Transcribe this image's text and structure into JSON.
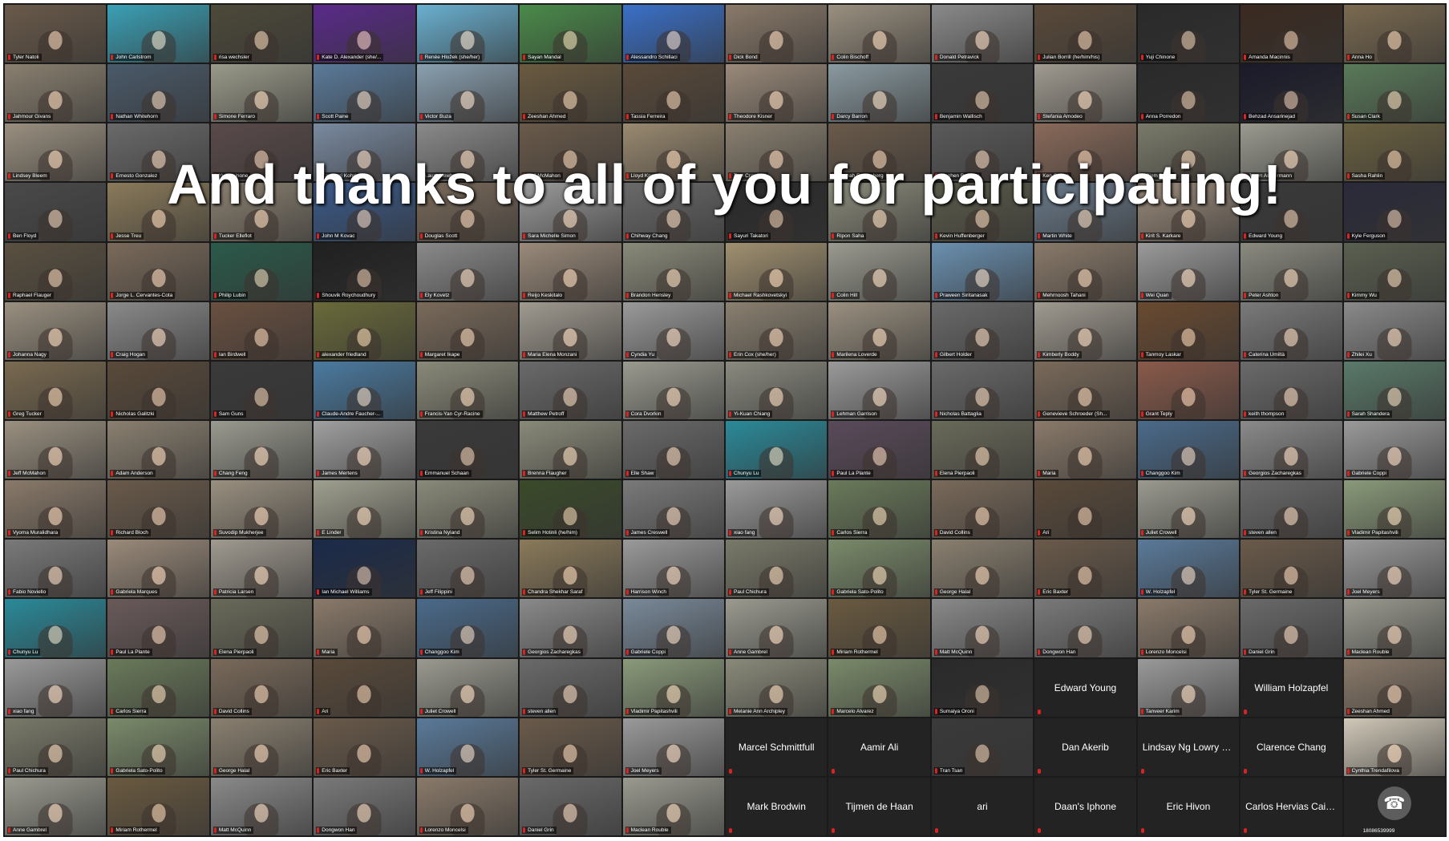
{
  "banner": "And thanks to all of you for participating!",
  "tiles": [
    {
      "n": "Tyler Natoli",
      "c": "#6a5a4a"
    },
    {
      "n": "John Carlstrom",
      "c": "#3aa0b5"
    },
    {
      "n": "risa wechsler",
      "c": "#4d4a3a"
    },
    {
      "n": "Kate D. Alexander (she/...",
      "c": "#5a2a8a"
    },
    {
      "n": "Renée Hložek (she/her)",
      "c": "#6ab0d0"
    },
    {
      "n": "Sayan Mandal",
      "c": "#4a8a4a"
    },
    {
      "n": "Alessandro Schillaci",
      "c": "#3a70c8"
    },
    {
      "n": "Dick Bond",
      "c": "#8a7a6a"
    },
    {
      "n": "Colin Bischoff",
      "c": "#9a9080"
    },
    {
      "n": "Donald Petravick",
      "c": "#8a8a8a"
    },
    {
      "n": "Julian Borrill (he/him/his)",
      "c": "#5a4a3a"
    },
    {
      "n": "Yuji Chinone",
      "c": "#2a2a2a"
    },
    {
      "n": "Amanda Macinnis",
      "c": "#3a2a20"
    },
    {
      "n": "Anna Ho",
      "c": "#7a6a50"
    },
    {
      "n": "Jahmour Givans",
      "c": "#8a8070"
    },
    {
      "n": "Nathan Whitehorn",
      "c": "#4a5a6a"
    },
    {
      "n": "Simone Ferraro",
      "c": "#9a9a8a"
    },
    {
      "n": "Scott Paine",
      "c": "#5a7a9a"
    },
    {
      "n": "Victor Buza",
      "c": "#8aa0b0"
    },
    {
      "n": "Zeeshan Ahmed",
      "c": "#6a5a40"
    },
    {
      "n": "Tassia Ferreira",
      "c": "#5a4a3a"
    },
    {
      "n": "Theodore Kisner",
      "c": "#9a8a7a"
    },
    {
      "n": "Darcy Barron",
      "c": "#8a9aa0"
    },
    {
      "n": "Benjamin Wallisch",
      "c": "#3a3a3a"
    },
    {
      "n": "Stefania Amodeo",
      "c": "#a09a90"
    },
    {
      "n": "Anna Porredon",
      "c": "#2a2a2a"
    },
    {
      "n": "Behzad Ansarinejad",
      "c": "#1a1a2a"
    },
    {
      "n": "Susan Clark",
      "c": "#5a7a5a"
    },
    {
      "n": "Lindsey Bleem",
      "c": "#9a9080"
    },
    {
      "n": "Ernesto Gonzalez",
      "c": "#6a6a6a"
    },
    {
      "n": "Yuji Chinone",
      "c": "#5a4a4a"
    },
    {
      "n": "Kazunori Kohri",
      "c": "#7a8aa0"
    },
    {
      "n": "Laura Newburgh",
      "c": "#8a8a8a"
    },
    {
      "n": "Jeff McMahon",
      "c": "#6a5a4a"
    },
    {
      "n": "Lloyd Knox",
      "c": "#9a8a70"
    },
    {
      "n": "Tom Crawford",
      "c": "#8a8070"
    },
    {
      "n": "Hannah Fronenberg",
      "c": "#6a5a4a"
    },
    {
      "n": "Stephen Bensley",
      "c": "#5a5a5a"
    },
    {
      "n": "Ken Ganga",
      "c": "#8a6a5a"
    },
    {
      "n": "Clem Pryke",
      "c": "#7a7a6a"
    },
    {
      "n": "Jason Austermann",
      "c": "#9a9a90"
    },
    {
      "n": "Sasha Rahlin",
      "c": "#6a6040"
    },
    {
      "n": "Ben Floyd",
      "c": "#4a4a4a"
    },
    {
      "n": "Jesse Treu",
      "c": "#8a7a5a"
    },
    {
      "n": "Tucker Elleflot",
      "c": "#8a8070"
    },
    {
      "n": "John M Kovac",
      "c": "#3a5a8a"
    },
    {
      "n": "Douglas Scott",
      "c": "#7a6a5a"
    },
    {
      "n": "Sara Michelle Simon",
      "c": "#9a9a9a"
    },
    {
      "n": "Chihway Chang",
      "c": "#6a6a6a"
    },
    {
      "n": "Sayuri Takatori",
      "c": "#2a2a2a"
    },
    {
      "n": "Ripon Saha",
      "c": "#8a8a7a"
    },
    {
      "n": "Kevin Huffenberger",
      "c": "#5a5a4a"
    },
    {
      "n": "Martin White",
      "c": "#6a7a8a"
    },
    {
      "n": "Kirit S. Karkare",
      "c": "#9a8a7a"
    },
    {
      "n": "Edward Young",
      "c": "#3a3a3a"
    },
    {
      "n": "Kyle Ferguson",
      "c": "#2a2a3a"
    },
    {
      "n": "Raphael Flauger",
      "c": "#5a5040"
    },
    {
      "n": "Jorge L. Cervantes-Cota",
      "c": "#7a6a5a"
    },
    {
      "n": "Philip Lubin",
      "c": "#2a5a4a"
    },
    {
      "n": "Shouvik Roychoudhury",
      "c": "#202020"
    },
    {
      "n": "Ely Kovetz",
      "c": "#8a8a8a"
    },
    {
      "n": "Reijo Keskitalo",
      "c": "#9a8a7a"
    },
    {
      "n": "Brandon Hensley",
      "c": "#8a8a7a"
    },
    {
      "n": "Michael Rashkovetskyi",
      "c": "#a09070"
    },
    {
      "n": "Colin Hill",
      "c": "#9a9a90"
    },
    {
      "n": "Praween Siritanasak",
      "c": "#6a90b0"
    },
    {
      "n": "Mehrnoosh Tahani",
      "c": "#8a7a6a"
    },
    {
      "n": "Wei Quan",
      "c": "#9a9a9a"
    },
    {
      "n": "Peter Ashton",
      "c": "#8a8a80"
    },
    {
      "n": "Kimmy Wu",
      "c": "#5a6050"
    },
    {
      "n": "Johanna Nagy",
      "c": "#9a9080"
    },
    {
      "n": "Craig Hogan",
      "c": "#8a8a8a"
    },
    {
      "n": "Ian Birdwell",
      "c": "#6a5040"
    },
    {
      "n": "alexander friedland",
      "c": "#6a6a3a"
    },
    {
      "n": "Margaret Ikape",
      "c": "#7a6a5a"
    },
    {
      "n": "Maria Elena Monzani",
      "c": "#a09a90"
    },
    {
      "n": "Cyndia Yu",
      "c": "#9a9a9a"
    },
    {
      "n": "Erin Cox (she/her)",
      "c": "#8a8070"
    },
    {
      "n": "Marilena Loverde",
      "c": "#9a9080"
    },
    {
      "n": "Gilbert Holder",
      "c": "#6a6a6a"
    },
    {
      "n": "Kimberly Boddy",
      "c": "#a09a90"
    },
    {
      "n": "Tanmoy Laskar",
      "c": "#6a4a30"
    },
    {
      "n": "Caterina Umiltà",
      "c": "#7a7a7a"
    },
    {
      "n": "Zhilei Xu",
      "c": "#8a8a8a"
    },
    {
      "n": "Greg Tucker",
      "c": "#7a6a50"
    },
    {
      "n": "Nicholas Galitzki",
      "c": "#5a4a3a"
    },
    {
      "n": "Sam Guns",
      "c": "#3a3a3a"
    },
    {
      "n": "Claude-Andre Faucher-...",
      "c": "#4a7aa0"
    },
    {
      "n": "Francis-Yan Cyr-Racine",
      "c": "#8a8a7a"
    },
    {
      "n": "Matthew Petroff",
      "c": "#6a6a6a"
    },
    {
      "n": "Cora Dvorkin",
      "c": "#9a9a90"
    },
    {
      "n": "Yi-Kuan Chiang",
      "c": "#8a8a80"
    },
    {
      "n": "Lehman Garrison",
      "c": "#9a9a9a"
    },
    {
      "n": "Nicholas Battaglia",
      "c": "#6a6a6a"
    },
    {
      "n": "Genevieve Schroeder (Sh...",
      "c": "#7a6a5a"
    },
    {
      "n": "Grant Teply",
      "c": "#8a5a4a"
    },
    {
      "n": "keith thompson",
      "c": "#6a6a6a"
    },
    {
      "n": "Sarah Shandera",
      "c": "#5a7a6a"
    },
    {
      "n": "Jeff McMahon",
      "c": "#9a9080"
    },
    {
      "n": "Adam Anderson",
      "c": "#8a8070"
    },
    {
      "n": "Chang Feng",
      "c": "#9a9a90"
    },
    {
      "n": "James Mertens",
      "c": "#a0a0a0"
    },
    {
      "n": "Emmanuel Schaan",
      "c": "#3a3a3a"
    },
    {
      "n": "Brenna Flaugher",
      "c": "#8a8a7a"
    },
    {
      "n": "Elle Shaw",
      "c": "#6a6a6a"
    },
    {
      "n": "Chunyu Lu",
      "c": "#2a8a9a"
    },
    {
      "n": "Paul La Plante",
      "c": "#5a4a5a"
    },
    {
      "n": "Elena Pierpaoli",
      "c": "#6a6a5a"
    },
    {
      "n": "Maria",
      "c": "#8a7a6a"
    },
    {
      "n": "Changgoo Kim",
      "c": "#4a6a8a"
    },
    {
      "n": "Georgios Zacharegkas",
      "c": "#8a8a8a"
    },
    {
      "n": "Gabriele Coppi",
      "c": "#9a9a9a"
    },
    {
      "n": "Vyoma Muralidhara",
      "c": "#8a7a6a"
    },
    {
      "n": "Richard Bloch",
      "c": "#6a5a4a"
    },
    {
      "n": "Suvodip Mukherjee",
      "c": "#9a9080"
    },
    {
      "n": "E Linder",
      "c": "#a0a090"
    },
    {
      "n": "Kristina Nyland",
      "c": "#8a8a7a"
    },
    {
      "n": "Selim Hotinli (he/him)",
      "c": "#3a4a2a"
    },
    {
      "n": "James Creswell",
      "c": "#7a7a7a"
    },
    {
      "n": "xiao fang",
      "c": "#9a9a9a"
    },
    {
      "n": "Carlos Sierra",
      "c": "#6a7a5a"
    },
    {
      "n": "David Collins",
      "c": "#7a6a5a"
    },
    {
      "n": "Ari",
      "c": "#5a4a3a"
    },
    {
      "n": "Juliet Crowell",
      "c": "#9a9a90"
    },
    {
      "n": "steven allen",
      "c": "#6a6a6a"
    },
    {
      "n": "Vladimir Papitashvili",
      "c": "#8a9a7a"
    },
    {
      "n": "Fabio Noviello",
      "c": "#7a7a7a"
    },
    {
      "n": "Gabriela Marques",
      "c": "#9a8a7a"
    },
    {
      "n": "Patricia Larsen",
      "c": "#a09a90"
    },
    {
      "n": "Ian Michael Williams",
      "c": "#1a2a4a"
    },
    {
      "n": "Jeff Filippini",
      "c": "#6a6a6a"
    },
    {
      "n": "Chandra Shekhar Saraf",
      "c": "#8a7a5a"
    },
    {
      "n": "Harrison Winch",
      "c": "#9a9a9a"
    },
    {
      "n": "Paul Chichura",
      "c": "#7a7a6a"
    },
    {
      "n": "Gabriela Sato-Polito",
      "c": "#7a8a6a"
    },
    {
      "n": "George Halal",
      "c": "#8a8070"
    },
    {
      "n": "Eric Baxter",
      "c": "#6a5a4a"
    },
    {
      "n": "W. Holzapfel",
      "c": "#5a7a9a"
    },
    {
      "n": "Tyler St. Germaine",
      "c": "#6a5a4a"
    },
    {
      "n": "Joel Meyers",
      "c": "#9a9a9a"
    },
    {
      "n": "Chunyu Lu",
      "c": "#2a8a9a"
    },
    {
      "n": "Paul La Plante",
      "c": "#6a5a5a"
    },
    {
      "n": "Elena Pierpaoli",
      "c": "#6a6a5a"
    },
    {
      "n": "Maria",
      "c": "#8a7a6a"
    },
    {
      "n": "Changgoo Kim",
      "c": "#4a6a8a"
    },
    {
      "n": "Georgios Zacharegkas",
      "c": "#8a8a8a"
    },
    {
      "n": "Gabriele Coppi",
      "c": "#7a8a9a"
    },
    {
      "n": "Anne Gambrel",
      "c": "#9a9a90"
    },
    {
      "n": "Miriam Rothermel",
      "c": "#6a5a40"
    },
    {
      "n": "Matt McQuinn",
      "c": "#8a8a8a"
    },
    {
      "n": "Dongwon Han",
      "c": "#7a7a7a"
    },
    {
      "n": "Lorenzo Moncelsi",
      "c": "#8a7a6a"
    },
    {
      "n": "Daniel Grin",
      "c": "#6a6a6a"
    },
    {
      "n": "Maclean Rouble",
      "c": "#9a9a90"
    },
    {
      "n": "xiao fang",
      "c": "#9a9a9a"
    },
    {
      "n": "Carlos Sierra",
      "c": "#6a7a5a"
    },
    {
      "n": "David Collins",
      "c": "#7a6a5a"
    },
    {
      "n": "Ari",
      "c": "#5a4a3a"
    },
    {
      "n": "Juliet Crowell",
      "c": "#9a9a90"
    },
    {
      "n": "steven allen",
      "c": "#6a6a6a"
    },
    {
      "n": "Vladimir Papitashvili",
      "c": "#8a9a7a"
    },
    {
      "n": "Melanie Ann Archipley",
      "c": "#8a8a7a"
    },
    {
      "n": "Marcelo Alvarez",
      "c": "#7a8a6a"
    },
    {
      "n": "Sumaiya Oroni",
      "c": "#2a2a2a"
    },
    {
      "n": "Edward Young",
      "off": true
    },
    {
      "n": "Tanveer Karim",
      "c": "#9a9a9a"
    },
    {
      "n": "William Holzapfel",
      "off": true
    },
    {
      "n": "Zeeshan Ahmed",
      "c": "#8a7a6a"
    },
    {
      "n": "Paul Chichura",
      "c": "#7a7a6a"
    },
    {
      "n": "Gabriela Sato-Polito",
      "c": "#7a8a6a"
    },
    {
      "n": "George Halal",
      "c": "#8a8070"
    },
    {
      "n": "Eric Baxter",
      "c": "#6a5a4a"
    },
    {
      "n": "W. Holzapfel",
      "c": "#5a7a9a"
    },
    {
      "n": "Tyler St. Germaine",
      "c": "#6a5a4a"
    },
    {
      "n": "Joel Meyers",
      "c": "#9a9a9a"
    },
    {
      "n": "Marcel Schmittfull",
      "off": true
    },
    {
      "n": "Aamir Ali",
      "off": true
    },
    {
      "n": "Tran Tsan",
      "c": "#3a3a3a"
    },
    {
      "n": "Dan Akerib",
      "off": true
    },
    {
      "n": "Lindsay Ng Lowry (sh...",
      "off": true
    },
    {
      "n": "Clarence Chang",
      "off": true
    },
    {
      "n": "Cynthia Trendafilova",
      "c": "#d0c8b8"
    },
    {
      "n": "Anne Gambrel",
      "c": "#9a9a90"
    },
    {
      "n": "Miriam Rothermel",
      "c": "#6a5a40"
    },
    {
      "n": "Matt McQuinn",
      "c": "#8a8a8a"
    },
    {
      "n": "Dongwon Han",
      "c": "#7a7a7a"
    },
    {
      "n": "Lorenzo Moncelsi",
      "c": "#8a7a6a"
    },
    {
      "n": "Daniel Grin",
      "c": "#6a6a6a"
    },
    {
      "n": "Maclean Rouble",
      "c": "#9a9a90"
    },
    {
      "n": "Mark Brodwin",
      "off": true
    },
    {
      "n": "Tijmen de Haan",
      "off": true
    },
    {
      "n": "ari",
      "off": true
    },
    {
      "n": "Daan's Iphone",
      "off": true
    },
    {
      "n": "Eric Hivon",
      "off": true
    },
    {
      "n": "Carlos Hervias Caima...",
      "off": true
    },
    {
      "n": "18086539999",
      "phone": true
    }
  ]
}
